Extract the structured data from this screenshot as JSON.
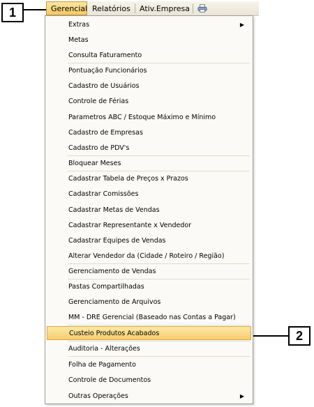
{
  "callouts": {
    "first": "1",
    "second": "2"
  },
  "menubar": {
    "items": [
      "Gerencial",
      "Relatórios",
      "Ativ.Empresa"
    ],
    "printer_icon": "printer-icon"
  },
  "menu": {
    "items": [
      "Extras",
      "Metas",
      "Consulta Faturamento",
      "Pontuação Funcionários",
      "Cadastro de Usuários",
      "Controle de Férias",
      "Parametros ABC / Estoque Máximo e Mínimo",
      "Cadastro de Empresas",
      "Cadastro de PDV's",
      "Bloquear Meses",
      "Cadastrar Tabela de Preços x Prazos",
      "Cadastrar Comissões",
      "Cadastrar Metas de Vendas",
      "Cadastrar Representante x Vendedor",
      "Cadastrar Equipes de Vendas",
      "Alterar Vendedor da (Cidade / Roteiro / Região)",
      "Gerenciamento de Vendas",
      "Pastas Compartilhadas",
      "Gerenciamento de Arquivos",
      "MM - DRE Gerencial (Baseado nas Contas a Pagar)",
      "Custeio Produtos Acabados",
      "Auditoria - Alterações",
      "Folha de Pagamento",
      "Controle de Documentos",
      "Outras Operações"
    ],
    "submenu_arrow": "▶"
  },
  "colors": {
    "highlight": "#f7cd6d",
    "menu_bg": "#fbfaf6"
  }
}
